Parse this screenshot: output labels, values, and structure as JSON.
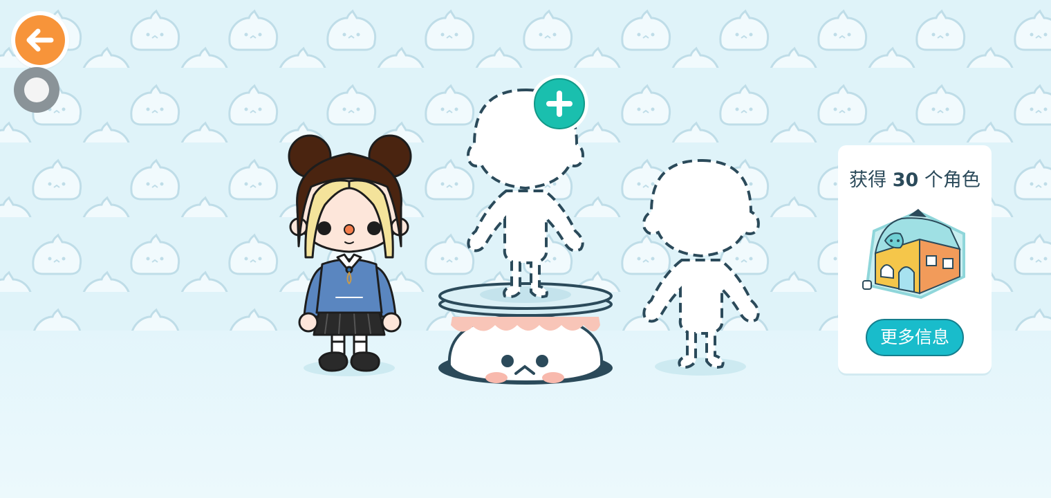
{
  "toolbar": {
    "back_icon": "arrow-left-icon",
    "record_icon": "record-icon"
  },
  "scene": {
    "add_character_icon": "plus-icon",
    "empty_slots": 2
  },
  "info_panel": {
    "title_prefix": "获得",
    "title_count": "30",
    "title_suffix": "个角色",
    "more_info_label": "更多信息"
  },
  "colors": {
    "back_button": "#f7943a",
    "add_button": "#1abfae",
    "more_info_button": "#19bccb",
    "outline": "#2b4a5a",
    "wallpaper": "#dff3f9"
  }
}
